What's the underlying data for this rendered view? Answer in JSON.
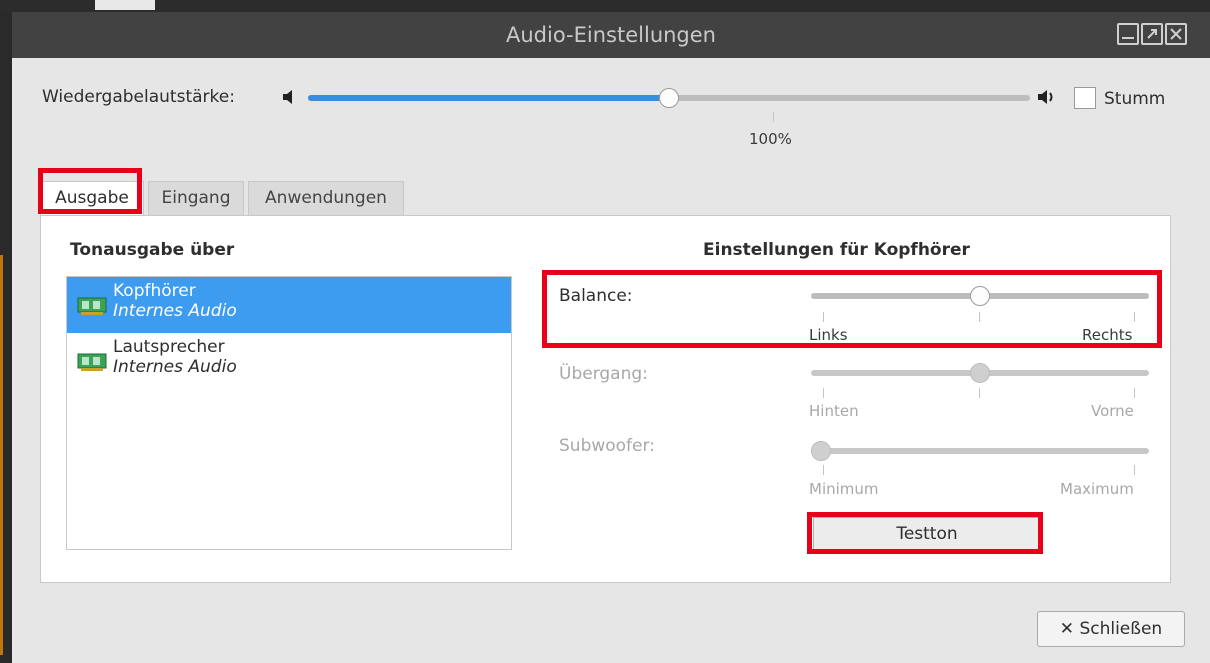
{
  "window": {
    "title": "Audio-Einstellungen"
  },
  "volume": {
    "label": "Wiedergabelautstärke:",
    "value_text": "100%",
    "value_fraction": 0.5,
    "mute_label": "Stumm",
    "mute_checked": false
  },
  "tabs": [
    {
      "label": "Ausgabe",
      "active": true
    },
    {
      "label": "Eingang",
      "active": false
    },
    {
      "label": "Anwendungen",
      "active": false
    }
  ],
  "output": {
    "heading": "Tonausgabe über",
    "devices": [
      {
        "name": "Kopfhörer",
        "subtitle": "Internes Audio",
        "selected": true,
        "icon": "sound-card-icon"
      },
      {
        "name": "Lautsprecher",
        "subtitle": "Internes Audio",
        "selected": false,
        "icon": "sound-card-icon"
      }
    ]
  },
  "settings": {
    "heading": "Einstellungen für Kopfhörer",
    "balance": {
      "label": "Balance:",
      "min_label": "Links",
      "max_label": "Rechts",
      "value_fraction": 0.5,
      "enabled": true
    },
    "fade": {
      "label": "Übergang:",
      "min_label": "Hinten",
      "max_label": "Vorne",
      "value_fraction": 0.5,
      "enabled": false
    },
    "subwoofer": {
      "label": "Subwoofer:",
      "min_label": "Minimum",
      "max_label": "Maximum",
      "value_fraction": 0.0,
      "enabled": false
    },
    "test_button": "Testton"
  },
  "close_button": {
    "icon": "close-icon",
    "glyph": "✕",
    "label": "Schließen"
  },
  "colors": {
    "accent": "#3a8dde",
    "selection": "#3d9bf0",
    "highlight": "#e8001a"
  }
}
